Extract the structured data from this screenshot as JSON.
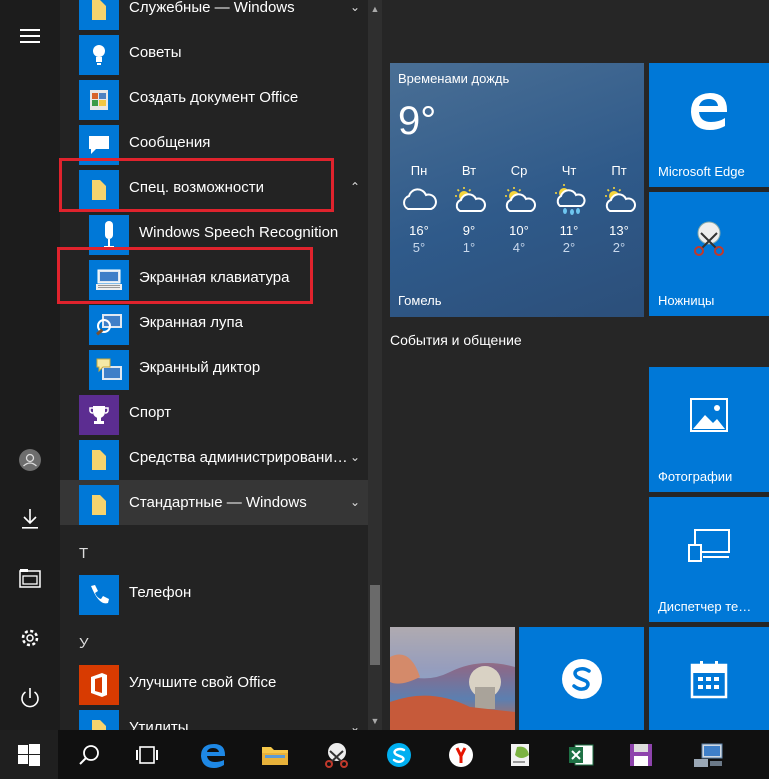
{
  "rail": {
    "items": [
      "menu-icon",
      "user-icon",
      "downloads-icon",
      "explorer-icon",
      "settings-icon",
      "power-icon"
    ]
  },
  "applist": {
    "items": [
      {
        "label": "Служебные — Windows",
        "chevron": "⌄",
        "icon": "folder-icon"
      },
      {
        "label": "Советы",
        "icon": "lightbulb-icon"
      },
      {
        "label": "Создать документ Office",
        "icon": "office-doc-icon"
      },
      {
        "label": "Сообщения",
        "icon": "message-icon"
      },
      {
        "label": "Спец. возможности",
        "chevron": "⌃",
        "icon": "folder-icon"
      },
      {
        "label": "Windows Speech Recognition",
        "icon": "microphone-icon"
      },
      {
        "label": "Экранная клавиатура",
        "icon": "keyboard-icon"
      },
      {
        "label": "Экранная лупа",
        "icon": "magnifier-icon"
      },
      {
        "label": "Экранный диктор",
        "icon": "narrator-icon"
      },
      {
        "label": "Спорт",
        "icon": "trophy-icon"
      },
      {
        "label": "Средства администрировани…",
        "chevron": "⌄",
        "icon": "folder-icon"
      },
      {
        "label": "Стандартные — Windows",
        "chevron": "⌄",
        "icon": "folder-icon"
      },
      {
        "label": "Телефон",
        "icon": "phone-icon"
      },
      {
        "label": "Улучшите свой Office",
        "icon": "office-icon"
      },
      {
        "label": "Утилиты",
        "chevron": "⌄",
        "icon": "folder-icon"
      }
    ],
    "letters": [
      "Т",
      "У"
    ]
  },
  "weather": {
    "condition": "Временами дождь",
    "temp": "9°",
    "city": "Гомель",
    "days": [
      {
        "day": "Пн",
        "hi": "16°",
        "lo": "5°",
        "icon": "cloud-icon"
      },
      {
        "day": "Вт",
        "hi": "9°",
        "lo": "1°",
        "icon": "partly-cloudy-icon"
      },
      {
        "day": "Ср",
        "hi": "10°",
        "lo": "4°",
        "icon": "partly-cloudy-icon"
      },
      {
        "day": "Чт",
        "hi": "11°",
        "lo": "2°",
        "icon": "rain-icon"
      },
      {
        "day": "Пт",
        "hi": "13°",
        "lo": "2°",
        "icon": "partly-cloudy-icon"
      }
    ]
  },
  "tiles": {
    "edge": "Microsoft Edge",
    "scissors": "Ножницы",
    "group_title": "События и общение",
    "photos": "Фотографии",
    "device_manager": "Диспетчер те…"
  },
  "taskbar": {
    "items": [
      "windows-start-icon",
      "search-icon",
      "task-view-icon",
      "edge-icon",
      "file-explorer-icon",
      "snipping-tool-icon",
      "skype-icon",
      "yandex-icon",
      "notepadpp-icon",
      "excel-icon",
      "save-floppy-icon",
      "network-computer-icon"
    ]
  },
  "colors": {
    "accent": "#0078d7",
    "highlight_red": "#e0232d"
  }
}
